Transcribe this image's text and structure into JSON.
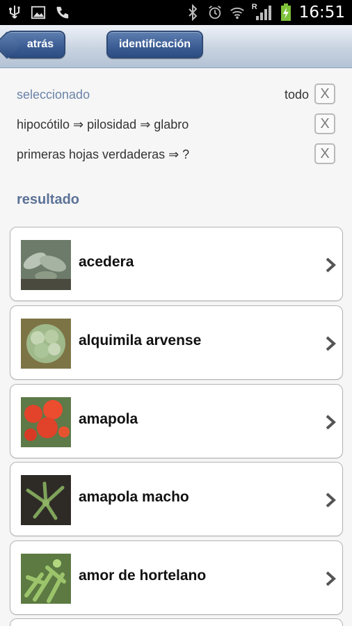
{
  "status_bar": {
    "time": "16:51",
    "icons": [
      "usb-icon",
      "image-icon",
      "phone-icon",
      "bluetooth-icon",
      "alarm-icon",
      "wifi-icon",
      "signal-icon",
      "battery-icon"
    ],
    "signal_label": "R"
  },
  "header": {
    "back_label": "atrás",
    "ident_label": "identificación"
  },
  "selection": {
    "title": "seleccionado",
    "all_label": "todo",
    "clear_label": "X",
    "rows": [
      {
        "text": "hipocótilo ⇒ pilosidad ⇒ glabro",
        "clear_label": "X"
      },
      {
        "text": "primeras hojas verdaderas ⇒ ?",
        "clear_label": "X"
      }
    ]
  },
  "result": {
    "title": "resultado",
    "items": [
      {
        "label": "acedera"
      },
      {
        "label": "alquimila arvense"
      },
      {
        "label": "amapola"
      },
      {
        "label": "amapola macho"
      },
      {
        "label": "amor de hortelano"
      }
    ]
  },
  "colors": {
    "accent": "#6a83a8",
    "button": "#3d5f96",
    "header": "#c8d3e1"
  }
}
